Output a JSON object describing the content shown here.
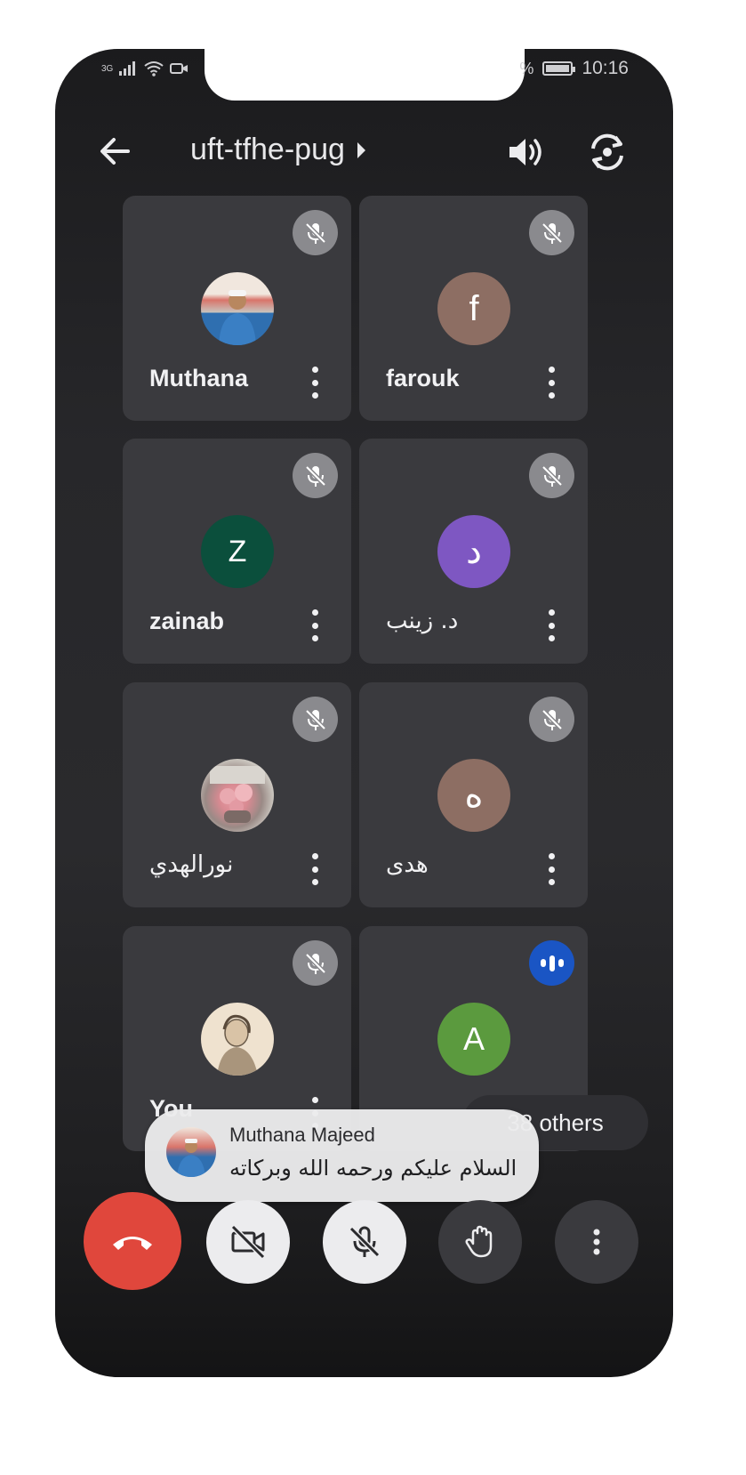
{
  "status": {
    "network": "3G",
    "time": "10:16",
    "battery_partial": "%"
  },
  "meeting": {
    "code": "uft-tfhe-pug"
  },
  "participants": [
    {
      "name": "Muthana",
      "avatar_type": "photo",
      "mic": "muted"
    },
    {
      "name": "farouk",
      "initial": "f",
      "avatar_color": "#8d6e63",
      "mic": "muted"
    },
    {
      "name": "zainab",
      "initial": "Z",
      "avatar_color": "#0b4f3c",
      "mic": "muted"
    },
    {
      "name": "د. زينب",
      "initial": "د",
      "avatar_color": "#7e57c2",
      "mic": "muted"
    },
    {
      "name": "نورالهدي",
      "avatar_type": "photo",
      "mic": "muted"
    },
    {
      "name": "هدى",
      "initial": "ه",
      "avatar_color": "#8d6e63",
      "mic": "muted"
    },
    {
      "name": "You",
      "avatar_type": "photo",
      "mic": "muted"
    },
    {
      "name": "A",
      "initial": "A",
      "avatar_color": "#5b9a3e",
      "mic": "speaking"
    }
  ],
  "others": {
    "label": "38 others"
  },
  "toast": {
    "sender": "Muthana Majeed",
    "message": "السلام عليكم ورحمه الله وبركاته"
  },
  "controls": {
    "end_call": "end-call-icon",
    "camera": "camera-off-icon",
    "mic": "mic-off-icon",
    "hand": "raise-hand-icon",
    "more": "more-vert-icon"
  },
  "colors": {
    "end_call": "#e0473c",
    "speaking": "#1a55c4",
    "tile_bg": "#3a3a3e"
  }
}
